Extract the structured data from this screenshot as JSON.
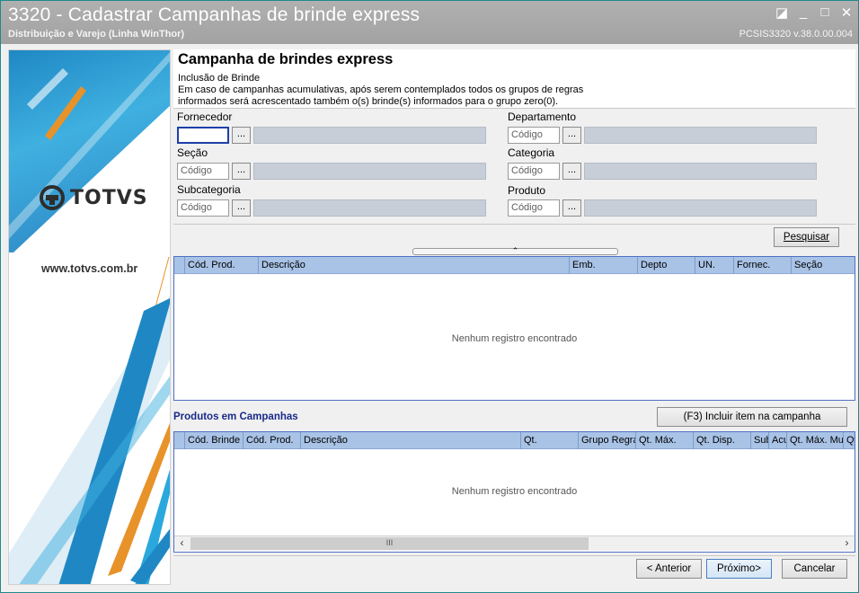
{
  "window": {
    "title": "3320 - Cadastrar Campanhas de brinde express",
    "subtitle": "Distribuição e Varejo (Linha WinThor)",
    "version": "PCSIS3320  v.38.0.00.004",
    "controls": {
      "restore": "◪",
      "minimize": "_",
      "maximize": "□",
      "close": "✕"
    }
  },
  "banner": {
    "logo_text": "TOTVS",
    "url": "www.totvs.com.br",
    "colors": {
      "blue": "#1f88c4",
      "orange": "#e8922a"
    }
  },
  "header": {
    "title": "Campanha de brindes express",
    "line1": "Inclusão de Brinde",
    "line2": "Em caso de campanhas acumulativas, após serem contemplados todos os grupos de regras",
    "line3": "informados será acrescentado também o(s) brinde(s) informados para o grupo zero(0)."
  },
  "filters": {
    "fornecedor": {
      "label": "Fornecedor",
      "value": "",
      "placeholder": ""
    },
    "departamento": {
      "label": "Departamento",
      "placeholder": "Código"
    },
    "secao": {
      "label": "Seção",
      "placeholder": "Código"
    },
    "categoria": {
      "label": "Categoria",
      "placeholder": "Código"
    },
    "subcategoria": {
      "label": "Subcategoria",
      "placeholder": "Código"
    },
    "produto": {
      "label": "Produto",
      "placeholder": "Código"
    },
    "ellipsis": "..."
  },
  "search_button": "Pesquisar",
  "products_grid": {
    "columns": [
      "Cód. Prod.",
      "Descrição",
      "Emb.",
      "Depto",
      "UN.",
      "Fornec.",
      "Seção"
    ],
    "empty_text": "Nenhum registro encontrado"
  },
  "campaign_section": {
    "title": "Produtos em Campanhas",
    "include_button": "(F3) Incluir item na campanha",
    "columns": [
      "Cód. Brinde",
      "Cód. Prod.",
      "Descrição",
      "Qt.",
      "Grupo Regra",
      "Qt. Máx.",
      "Qt. Disp.",
      "Sub",
      "Acu",
      "Qt. Máx. Mu",
      "Qt"
    ],
    "empty_text": "Nenhum registro encontrado",
    "scroll_thumb": "III"
  },
  "footer": {
    "back": "< Anterior",
    "next": "Próximo>",
    "cancel": "Cancelar"
  }
}
